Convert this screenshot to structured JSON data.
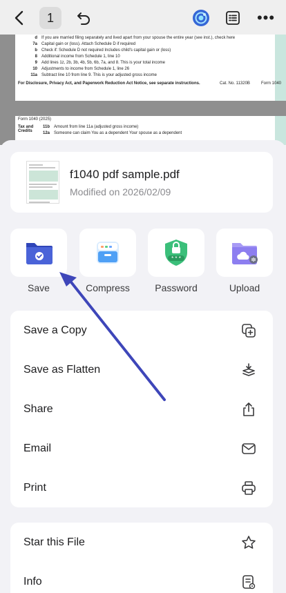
{
  "toolbar": {
    "page_number": "1",
    "more_label": "•••"
  },
  "pdf": {
    "lines": [
      {
        "num": "d",
        "text": "If you are married filing separately and lived apart from your spouse the entire year (see inst.), check here",
        "code": "7a"
      },
      {
        "num": "7a",
        "text": "Capital gain or (loss). Attach Schedule D if required",
        "code": ""
      },
      {
        "num": "b",
        "text": "Check if:   Schedule D not required     Includes child's capital gain or (loss)",
        "code": ""
      },
      {
        "num": "8",
        "text": "Additional income from Schedule 1, line 10",
        "code": "8"
      },
      {
        "num": "9",
        "text": "Add lines 1z, 2b, 3b, 4b, 5b, 6b, 7a, and 8. This is your total income",
        "code": "9"
      },
      {
        "num": "10",
        "text": "Adjustments to income from Schedule 1, line 26",
        "code": "10"
      },
      {
        "num": "11a",
        "text": "Subtract line 10 from line 9. This is your adjusted gross income",
        "code": "11a"
      }
    ],
    "footer": "For Disclosure, Privacy Act, and Paperwork Reduction Act Notice, see separate instructions.",
    "cat_no": "Cat. No. 11320B",
    "form_id": "Form 1040",
    "page2_header": "Form 1040 (2025)",
    "section": "Tax and Credits",
    "line_11b": "Amount from line 11a (adjusted gross income)",
    "line_12a": "Someone can claim      You as a dependent      Your spouse as a dependent"
  },
  "file": {
    "name": "f1040 pdf sample.pdf",
    "modified": "Modified on 2026/02/09"
  },
  "actions": [
    {
      "label": "Save"
    },
    {
      "label": "Compress"
    },
    {
      "label": "Password"
    },
    {
      "label": "Upload"
    }
  ],
  "menu1": [
    {
      "label": "Save a Copy"
    },
    {
      "label": "Save as Flatten"
    },
    {
      "label": "Share"
    },
    {
      "label": "Email"
    },
    {
      "label": "Print"
    }
  ],
  "menu2": [
    {
      "label": "Star this File"
    },
    {
      "label": "Info"
    }
  ],
  "colors": {
    "accent": "#3f51b5",
    "arrow": "#3e46b9",
    "password_green": "#3bbf7a",
    "folder_purple": "#8d7ef0"
  }
}
